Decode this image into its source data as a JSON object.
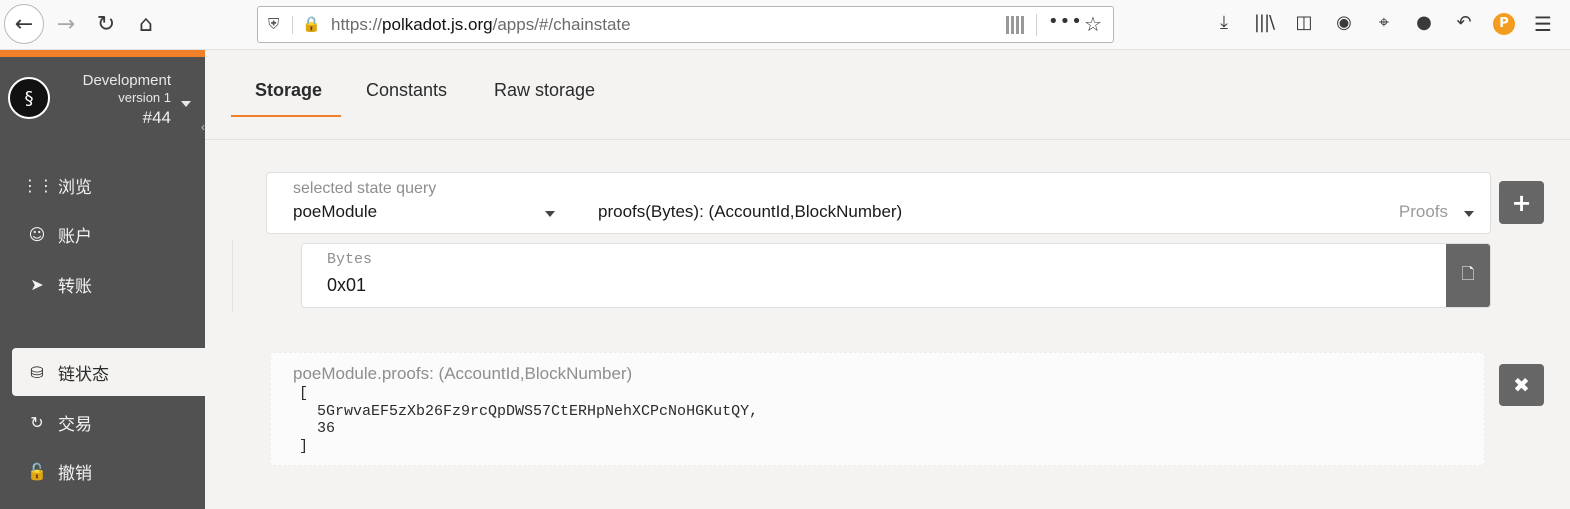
{
  "browser": {
    "url_prefix": "https://",
    "url_host": "polkadot.js.org",
    "url_path": "/apps/#/chainstate",
    "icons": [
      "back-arrow-icon",
      "forward-arrow-icon",
      "reload-icon",
      "home-icon",
      "shield-icon",
      "lock-icon",
      "qr-code-icon",
      "more-icon",
      "bookmark-star-icon",
      "download-icon",
      "library-icon",
      "sidebar-icon",
      "account-icon",
      "crop-icon",
      "chat-icon",
      "undo-icon",
      "extension-icon",
      "menu-icon"
    ],
    "extension_letter": "P"
  },
  "sidebar": {
    "chain_name": "Development",
    "chain_version": "version 1",
    "block_number": "#44",
    "items": [
      {
        "label": "浏览",
        "icon": "th"
      },
      {
        "label": "账户",
        "icon": "users"
      },
      {
        "label": "转账",
        "icon": "send"
      },
      {
        "label": "链状态",
        "icon": "database"
      },
      {
        "label": "交易",
        "icon": "sync"
      },
      {
        "label": "撤销",
        "icon": "unlock"
      }
    ],
    "accent_color": "#f0812a"
  },
  "tabs": [
    {
      "label": "Storage",
      "active": true
    },
    {
      "label": "Constants",
      "active": false
    },
    {
      "label": "Raw storage",
      "active": false
    }
  ],
  "query": {
    "label": "selected state query",
    "module": "poeModule",
    "method": "proofs(Bytes): (AccountId,BlockNumber)",
    "return_type": "Proofs"
  },
  "param": {
    "label": "Bytes",
    "value": "0x01"
  },
  "result": {
    "label": "poeModule.proofs: (AccountId,BlockNumber)",
    "body": "[\n  5GrwvaEF5zXb26Fz9rcQpDWS57CtERHpNehXCPcNoHGKutQY,\n  36\n]"
  }
}
